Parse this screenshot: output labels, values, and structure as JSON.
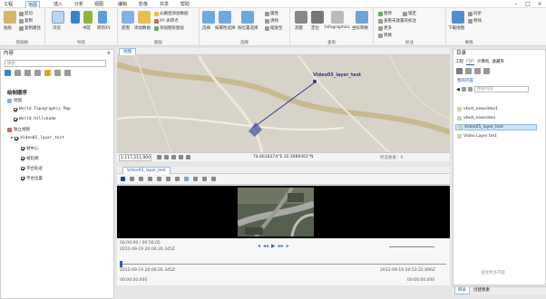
{
  "app": {
    "tabs": [
      "工程",
      "地图",
      "插入",
      "分析",
      "视图",
      "编辑",
      "影像",
      "共享",
      "帮助"
    ],
    "active_tab": "地图"
  },
  "ribbon": {
    "clipboard": {
      "label": "剪贴板",
      "paste": "粘贴",
      "cut": "剪切",
      "copy": "复制",
      "copy_path": "复制路径"
    },
    "navigate": {
      "label": "导航",
      "explore": "浏览",
      "zoom": "缩放",
      "bookmarks": "书签",
      "goto": "转到XY"
    },
    "layer": {
      "label": "图层",
      "basemap": "底图",
      "add_data": "添加数据",
      "add_preset": "从路径添加数据",
      "add_xy": "XY 表转点",
      "add_graphics": "添加图形图层"
    },
    "selection": {
      "label": "选择",
      "select": "选择",
      "by_attr": "按属性选择",
      "by_loc": "按位置选择",
      "attributes": "属性",
      "clear": "清除",
      "zoom_to": "缩放至"
    },
    "inquiry": {
      "label": "查询",
      "measure": "测量",
      "locate": "定位",
      "infographics": "Infographics",
      "coordinate": "坐标转换"
    },
    "labeling": {
      "label": "标注",
      "convert": "转换",
      "more": "更多",
      "pause": "暂停",
      "lock": "锁定",
      "view_unplaced": "查看未放置的标注"
    },
    "offline": {
      "label": "离线",
      "download": "下载地图",
      "sync": "同步",
      "remove": "移除"
    }
  },
  "contents": {
    "title": "内容",
    "search_placeholder": "搜索",
    "drawing_order": "绘制顺序",
    "map": "地图",
    "layers": [
      "World Topographic Map",
      "World Hillshade"
    ],
    "standalone": "独立视频",
    "video_layer": "Video05_layer_test",
    "sublayers": [
      "帧中心",
      "帧轮廓",
      "平台轨迹",
      "平台位置"
    ]
  },
  "map_view": {
    "tab": "地图",
    "video_label": "Video05_layer_test",
    "scale": "1:117,211,900",
    "coords": "74.6618374°E 32.3089301°N",
    "selected": "所选要素：0"
  },
  "video_player": {
    "tab": "Video05_layer_test",
    "time1": "00:00:00 / 00:56:05",
    "date1": "2012-09-19 20:06:26.345Z",
    "date2": "2012-09-19 20:06:26.345Z",
    "date3": "2012-09-19 20:53:22.896Z",
    "time_start": "00:00:00.000",
    "time_end": "00:00:00.000"
  },
  "catalog": {
    "title": "目录",
    "tabs": [
      "工程",
      "门户",
      "计算机",
      "收藏夹"
    ],
    "my_content": "我的内容",
    "search_placeholder": "搜索内容",
    "items": [
      {
        "name": "vtest_newvideo1",
        "selected": false
      },
      {
        "name": "vtest_newvideo",
        "selected": false
      },
      {
        "name": "Video05_layer_test",
        "selected": true
      },
      {
        "name": "Video Layer test",
        "selected": false
      }
    ],
    "view_more": "查找更多内容"
  },
  "status": {
    "catalog_tab": "目录",
    "create_tab": "创建要素"
  }
}
